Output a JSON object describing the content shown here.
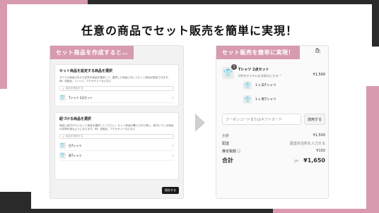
{
  "headline": "任意の商品でセット販売を簡単に実現！",
  "left_panel": {
    "tag": "セット商品を作成すると…",
    "card1": {
      "title": "セット商品を設定する商品を選択",
      "desc": "すべての商品の中から任意の商品を選択して、選択した商品に対してセット商品が設定できます。例）化粧品、Tシャツ、アクセサリーなどなど",
      "search_placeholder": "商品を検索する",
      "items": [
        {
          "label": "Tシャツ 2点セット"
        }
      ]
    },
    "card2": {
      "title": "紐づける商品を選択",
      "desc": "商品に紐付けたいセット商品を選択してください。セット商品が購入された時に、紐付いている商品の在庫が減るようになります。例）化粧品、アクセサリーなどなど",
      "search_placeholder": "商品を検索する",
      "items": [
        {
          "label": "白Tシャツ"
        },
        {
          "label": "黒Tシャツ"
        }
      ]
    },
    "save": "保存する"
  },
  "right_panel": {
    "tag": "セット販売を簡単に実現！",
    "bag_icon": "shopping-bag-icon",
    "item": {
      "qty": "1",
      "name": "Tシャツ 2点セット",
      "sub": "2件のアイテムを非表示にする ^",
      "price": "¥1,500"
    },
    "sub_items": [
      {
        "label": "1 x 白Tシャツ"
      },
      {
        "label": "1 x 黒Tシャツ"
      }
    ],
    "coupon_placeholder": "クーポンコードまたはギフトカード",
    "coupon_button": "適用する",
    "summary": {
      "subtotal_label": "小計",
      "subtotal": "¥1,500",
      "shipping_label": "配送",
      "shipping": "配送先住所を入力する",
      "tax_label": "推定税額 ⓘ",
      "tax": "¥150",
      "total_label": "合計",
      "total_currency": "JPY",
      "total": "¥1,650"
    }
  }
}
